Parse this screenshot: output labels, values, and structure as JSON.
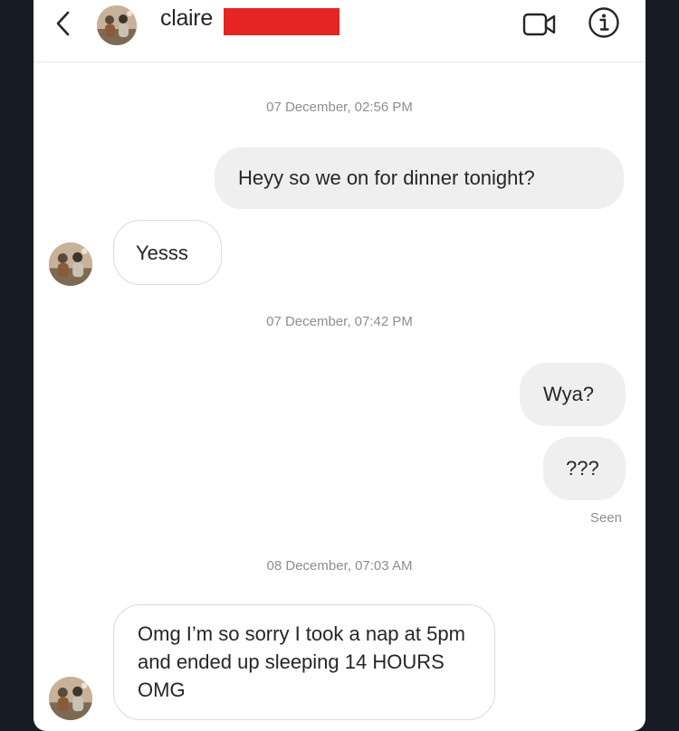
{
  "header": {
    "contact_name": "claire",
    "back_icon": "chevron-left-icon",
    "video_icon": "video-camera-icon",
    "info_icon": "info-icon",
    "redaction_color": "#e52424"
  },
  "conversation": [
    {
      "type": "timestamp",
      "text": "07 December, 02:56 PM"
    },
    {
      "type": "outgoing",
      "text": "Heyy so we on for dinner tonight?"
    },
    {
      "type": "incoming",
      "text": "Yesss"
    },
    {
      "type": "timestamp",
      "text": "07 December, 07:42 PM"
    },
    {
      "type": "outgoing",
      "text": "Wya?"
    },
    {
      "type": "outgoing",
      "text": "???"
    },
    {
      "type": "status",
      "text": "Seen"
    },
    {
      "type": "timestamp",
      "text": "08 December, 07:03 AM"
    },
    {
      "type": "incoming",
      "text": "Omg I’m so sorry I took a nap at 5pm and ended up sleeping 14 HOURS OMG"
    }
  ],
  "colors": {
    "outgoing_bubble": "#efefef",
    "incoming_border": "#dbdbdb",
    "meta_text": "#8e8e8e",
    "text": "#262626"
  }
}
